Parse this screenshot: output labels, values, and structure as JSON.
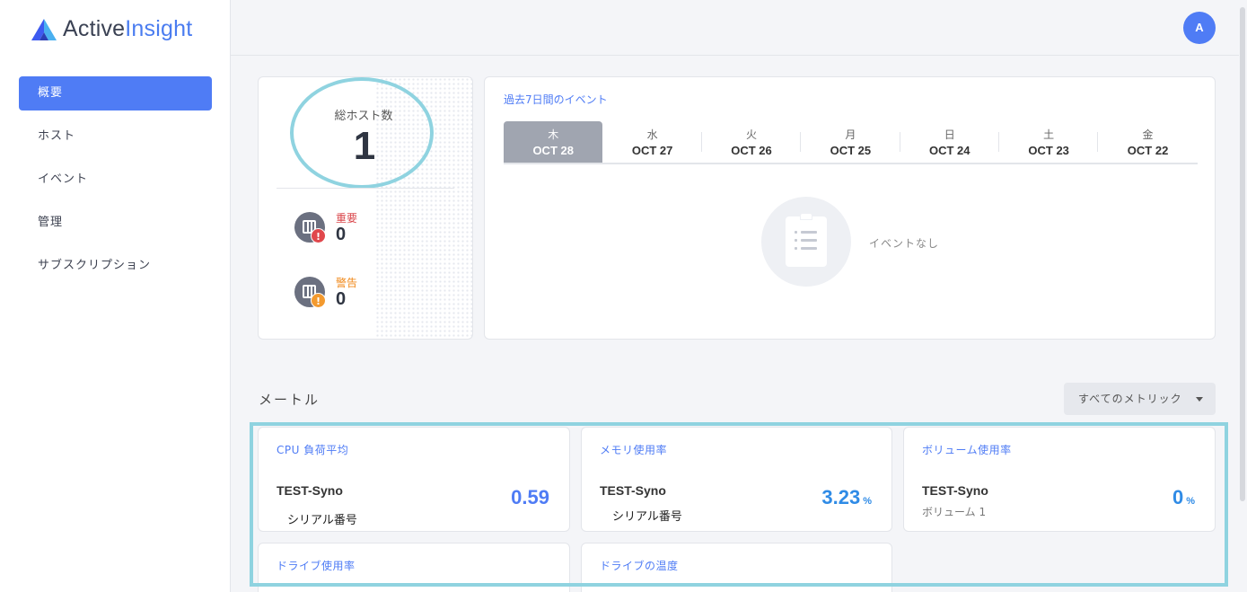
{
  "brand": {
    "name_part1": "Active",
    "name_part2": "Insight"
  },
  "sidebar": {
    "items": [
      {
        "label": "概要",
        "active": true
      },
      {
        "label": "ホスト",
        "active": false
      },
      {
        "label": "イベント",
        "active": false
      },
      {
        "label": "管理",
        "active": false
      },
      {
        "label": "サブスクリプション",
        "active": false
      }
    ]
  },
  "header": {
    "avatar_initial": "A"
  },
  "hosts": {
    "label": "総ホスト数",
    "count": "1",
    "critical": {
      "label": "重要",
      "value": "0",
      "color": "#e0474c"
    },
    "warning": {
      "label": "警告",
      "value": "0",
      "color": "#f39a2f"
    }
  },
  "events": {
    "title": "過去7日間のイベント",
    "days": [
      {
        "dow": "木",
        "date": "OCT 28",
        "active": true
      },
      {
        "dow": "水",
        "date": "OCT 27",
        "active": false
      },
      {
        "dow": "火",
        "date": "OCT 26",
        "active": false
      },
      {
        "dow": "月",
        "date": "OCT 25",
        "active": false
      },
      {
        "dow": "日",
        "date": "OCT 24",
        "active": false
      },
      {
        "dow": "土",
        "date": "OCT 23",
        "active": false
      },
      {
        "dow": "金",
        "date": "OCT 22",
        "active": false
      }
    ],
    "empty_text": "イベントなし"
  },
  "metrics": {
    "title": "メートル",
    "filter_label": "すべてのメトリック",
    "cards": [
      {
        "title": "CPU 負荷平均",
        "host": "TEST-Syno",
        "sub": "シリアル番号",
        "value": "0.59",
        "unit": "",
        "color": "#4f7cf5"
      },
      {
        "title": "メモリ使用率",
        "host": "TEST-Syno",
        "sub": "シリアル番号",
        "value": "3.23",
        "unit": "%",
        "color": "#2f8be6"
      },
      {
        "title": "ボリューム使用率",
        "host": "TEST-Syno",
        "sub": "ボリューム 1",
        "value": "0",
        "unit": "%",
        "color": "#2f8be6"
      },
      {
        "title": "ドライブ使用率"
      },
      {
        "title": "ドライブの温度"
      }
    ]
  }
}
